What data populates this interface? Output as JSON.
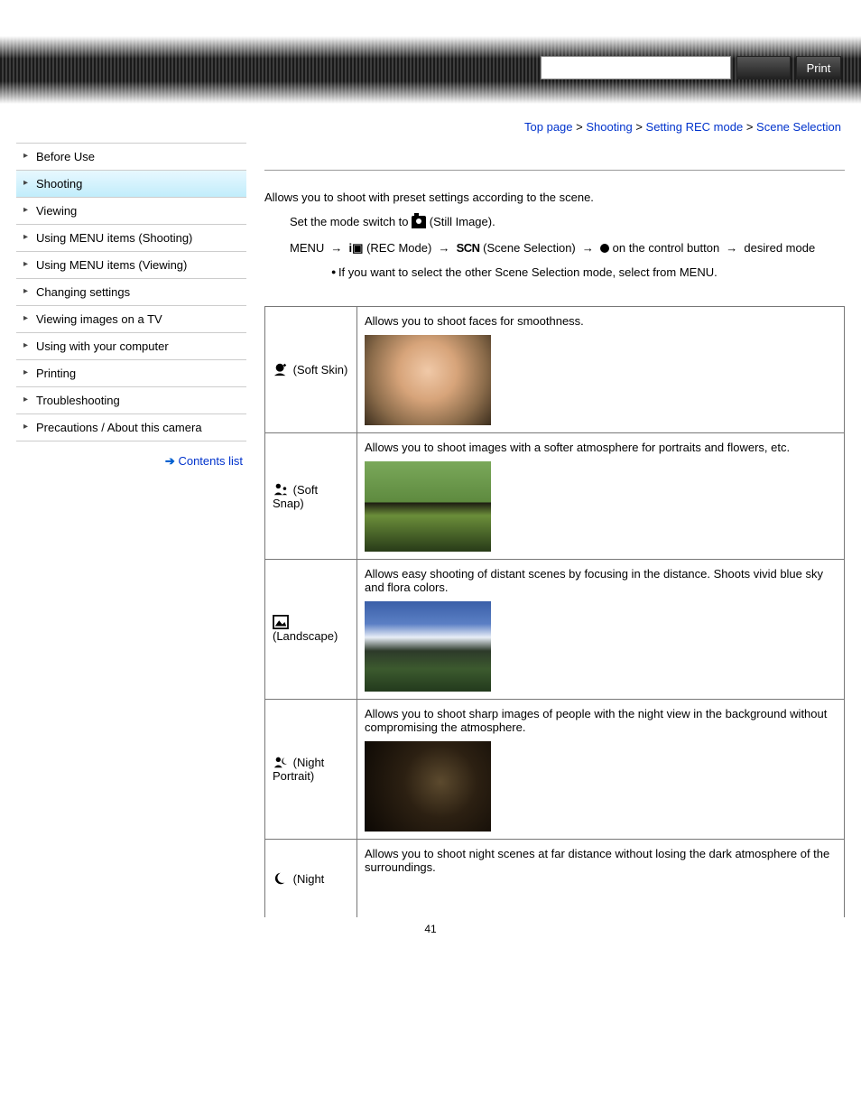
{
  "header": {
    "print_label": "Print"
  },
  "breadcrumb": {
    "items": [
      "Top page",
      "Shooting",
      "Setting REC mode",
      "Scene Selection"
    ]
  },
  "sidebar": {
    "items": [
      {
        "label": "Before Use"
      },
      {
        "label": "Shooting",
        "active": true
      },
      {
        "label": "Viewing"
      },
      {
        "label": "Using MENU items (Shooting)"
      },
      {
        "label": "Using MENU items (Viewing)"
      },
      {
        "label": "Changing settings"
      },
      {
        "label": "Viewing images on a TV"
      },
      {
        "label": "Using with your computer"
      },
      {
        "label": "Printing"
      },
      {
        "label": "Troubleshooting"
      },
      {
        "label": "Precautions / About this camera"
      }
    ],
    "contents_link": "Contents list"
  },
  "main": {
    "intro": "Allows you to shoot with preset settings according to the scene.",
    "step1_a": "Set the mode switch to ",
    "step1_b": "(Still Image).",
    "step2_menu": "MENU",
    "step2_rec": "(REC Mode)",
    "step2_scn": "SCN",
    "step2_scene": "(Scene Selection)",
    "step2_control": " on the control button ",
    "step2_desired": " desired mode",
    "note": "If you want to select the other Scene Selection mode, select from MENU.",
    "scenes": [
      {
        "name": " (Soft Skin)",
        "desc": "Allows you to shoot faces for smoothness.",
        "img": "img-softskin"
      },
      {
        "name": " (Soft Snap)",
        "desc": "Allows you to shoot images with a softer atmosphere for portraits and flowers, etc.",
        "img": "img-softsnap"
      },
      {
        "name": " (Landscape)",
        "desc": "Allows easy shooting of distant scenes by focusing in the distance. Shoots vivid blue sky and flora colors.",
        "img": "img-landscape"
      },
      {
        "name": " (Night Portrait)",
        "desc": "Allows you to shoot sharp images of people with the night view in the background without compromising the atmosphere.",
        "img": "img-nightportrait"
      },
      {
        "name": " (Night",
        "desc": "Allows you to shoot night scenes at far distance without losing the dark atmosphere of the surroundings.",
        "img": ""
      }
    ],
    "page_number": "41"
  }
}
